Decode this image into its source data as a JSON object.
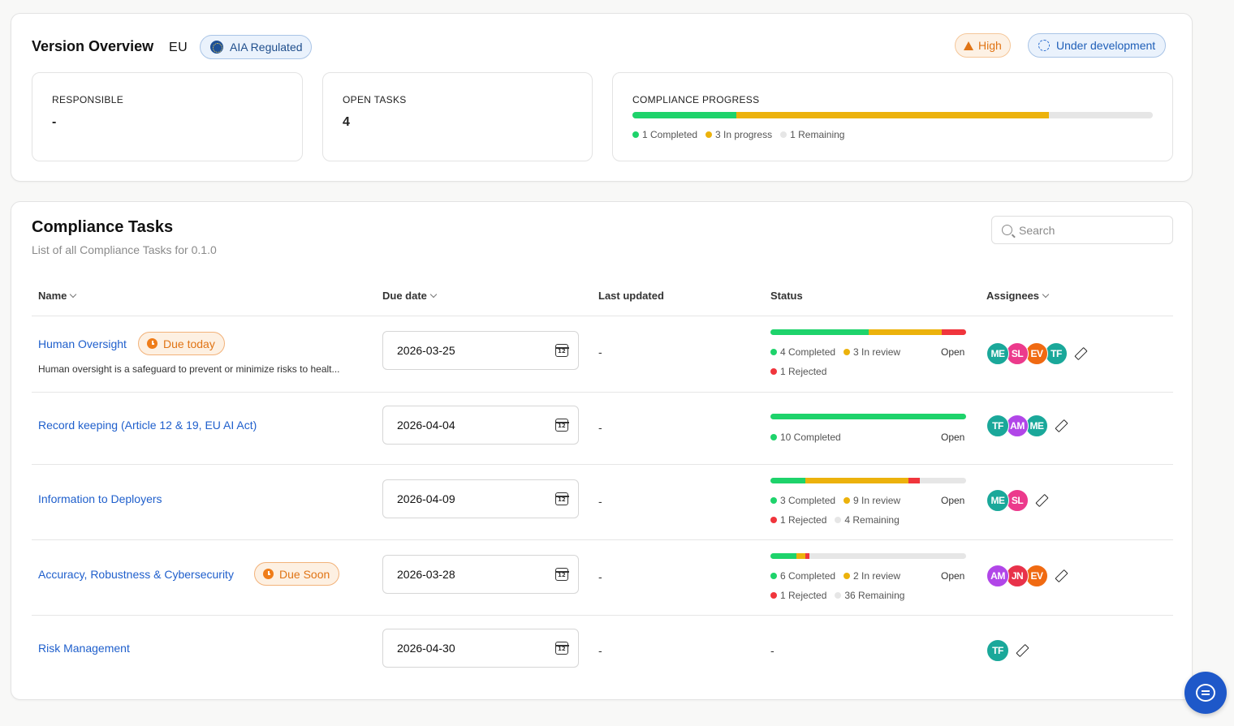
{
  "overview": {
    "title": "Version Overview",
    "region": "EU",
    "regulated_badge": "AIA Regulated",
    "risk_badge": "High",
    "status_badge": "Under development",
    "responsible_label": "RESPONSIBLE",
    "responsible_value": "-",
    "open_tasks_label": "OPEN TASKS",
    "open_tasks_value": "4",
    "progress_label": "COMPLIANCE PROGRESS",
    "progress": {
      "completed": 1,
      "in_progress": 3,
      "remaining": 1
    },
    "progress_legend": {
      "completed": "1 Completed",
      "in_progress": "3 In progress",
      "remaining": "1 Remaining"
    }
  },
  "colors": {
    "green": "#1ed36b",
    "amber": "#ecb20c",
    "red": "#f0353c",
    "gray": "#e6e6e6",
    "link": "#1f5fcc",
    "accent": "#1e58c9",
    "orange": "#e07415"
  },
  "tasks": {
    "title": "Compliance Tasks",
    "subtitle": "List of all Compliance Tasks for 0.1.0",
    "search_placeholder": "Search",
    "columns": {
      "name": "Name",
      "due": "Due date",
      "updated": "Last updated",
      "status": "Status",
      "assignees": "Assignees"
    },
    "rows": [
      {
        "name": "Human Oversight",
        "badge": "Due today",
        "description": "Human oversight is a safeguard to prevent or minimize risks to healt...",
        "due": "2026-03-25",
        "updated": "-",
        "segments": {
          "completed": 4,
          "review": 3,
          "rejected": 1,
          "remaining": 0
        },
        "legend1": [
          "4 Completed",
          "3 In review"
        ],
        "legend2": [
          "1 Rejected"
        ],
        "state": "Open",
        "assignees": [
          "ME",
          "SL",
          "EV",
          "TF"
        ]
      },
      {
        "name": "Record keeping (Article 12 & 19, EU AI Act)",
        "badge": "",
        "description": "",
        "due": "2026-04-04",
        "updated": "-",
        "segments": {
          "completed": 10,
          "review": 0,
          "rejected": 0,
          "remaining": 0
        },
        "legend1": [
          "10 Completed"
        ],
        "legend2": [],
        "state": "Open",
        "assignees": [
          "TF",
          "AM",
          "ME"
        ]
      },
      {
        "name": "Information to Deployers",
        "badge": "",
        "description": "",
        "due": "2026-04-09",
        "updated": "-",
        "segments": {
          "completed": 3,
          "review": 9,
          "rejected": 1,
          "remaining": 4
        },
        "legend1": [
          "3 Completed",
          "9 In review"
        ],
        "legend2": [
          "1 Rejected",
          "4 Remaining"
        ],
        "state": "Open",
        "assignees": [
          "ME",
          "SL"
        ]
      },
      {
        "name": "Accuracy, Robustness & Cybersecurity",
        "badge": "Due Soon",
        "description": "",
        "due": "2026-03-28",
        "updated": "-",
        "segments": {
          "completed": 6,
          "review": 2,
          "rejected": 1,
          "remaining": 36
        },
        "legend1": [
          "6 Completed",
          "2 In review"
        ],
        "legend2": [
          "1 Rejected",
          "36 Remaining"
        ],
        "state": "Open",
        "assignees": [
          "AM",
          "JN",
          "EV"
        ]
      },
      {
        "name": "Risk Management",
        "badge": "",
        "description": "",
        "due": "2026-04-30",
        "updated": "-",
        "status_text": "-",
        "segments": null,
        "legend1": [],
        "legend2": [],
        "state": "",
        "assignees": [
          "TF"
        ]
      }
    ]
  },
  "avatar_colors": {
    "ME": "#1aa89a",
    "SL": "#ec3a8c",
    "EV": "#f06a12",
    "TF": "#1aa89a",
    "AM": "#b146e8",
    "JN": "#e8324a"
  }
}
